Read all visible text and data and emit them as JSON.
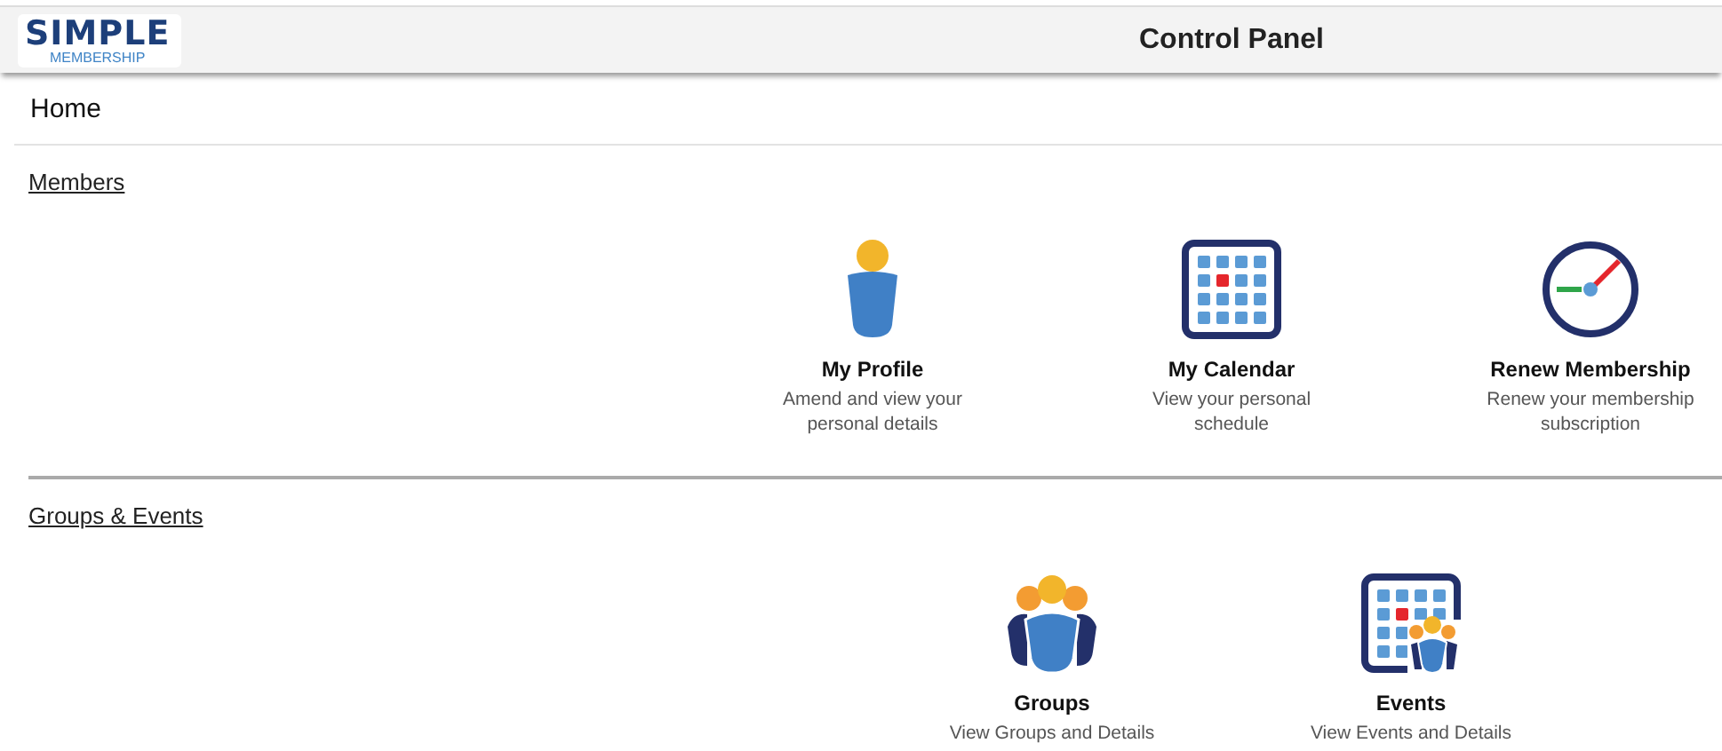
{
  "header": {
    "logo_top": "SIMPLE",
    "logo_bottom": "MEMBERSHIP",
    "title": "Control Panel"
  },
  "breadcrumb": "Home",
  "sections": [
    {
      "title": "Members",
      "tiles": [
        {
          "kind": "person",
          "title": "My Profile",
          "description": "Amend and view your personal details"
        },
        {
          "kind": "calendar",
          "title": "My Calendar",
          "description": "View your personal schedule"
        },
        {
          "kind": "clock",
          "title": "Renew Membership",
          "description": "Renew your membership subscription"
        }
      ]
    },
    {
      "title": "Groups & Events",
      "tiles": [
        {
          "kind": "group",
          "title": "Groups",
          "description": "View Groups and Details"
        },
        {
          "kind": "event",
          "title": "Events",
          "description": "View Events and Details"
        }
      ]
    }
  ]
}
